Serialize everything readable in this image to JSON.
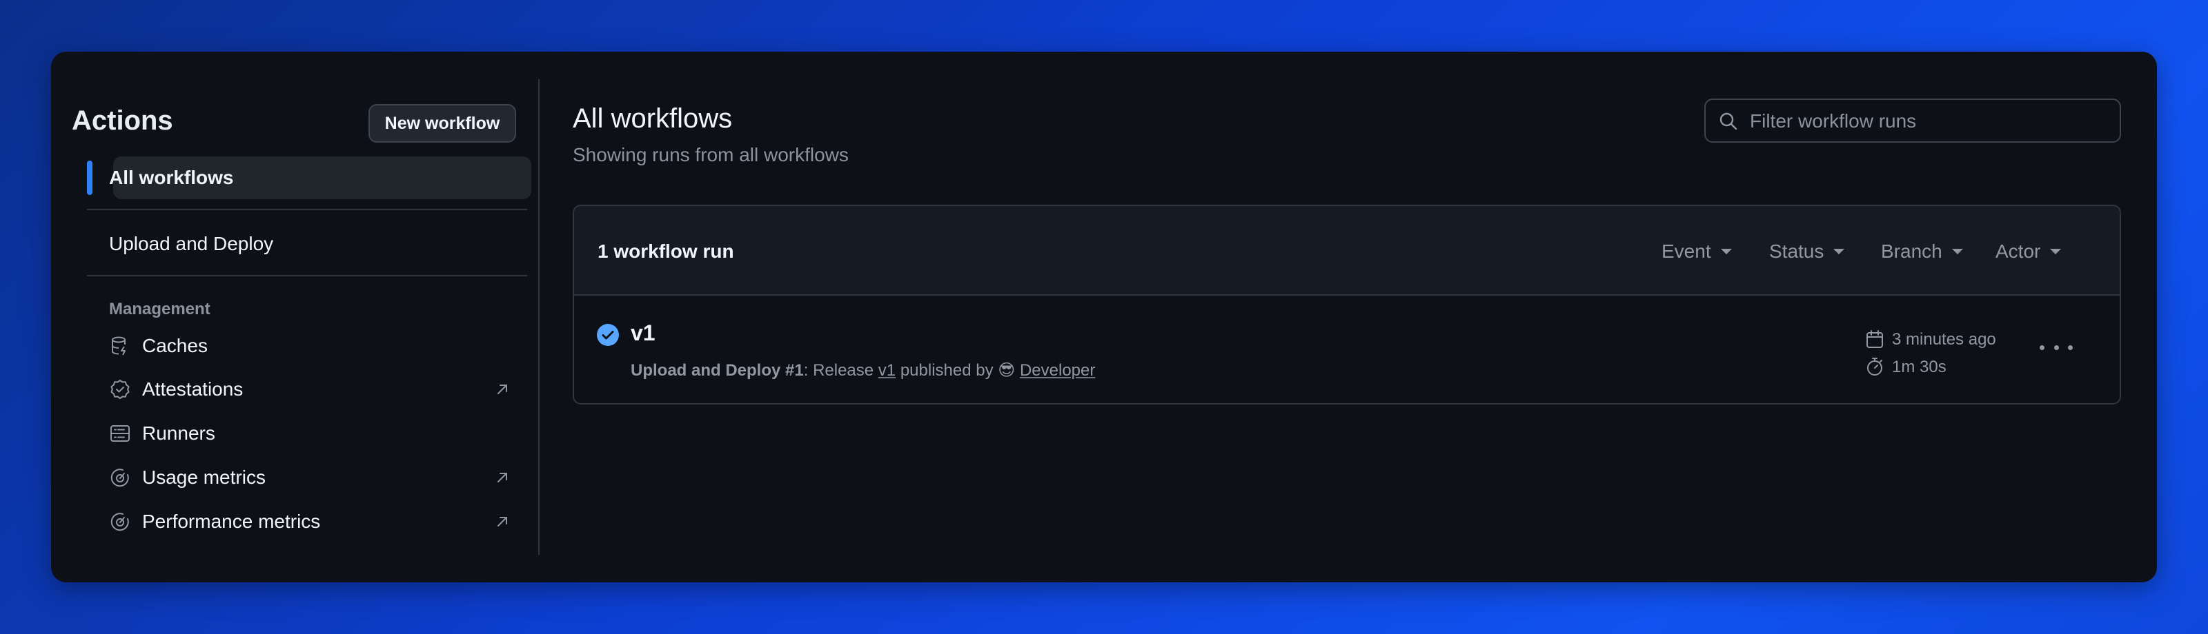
{
  "sidebar": {
    "title": "Actions",
    "new_workflow_label": "New workflow",
    "active_item": "All workflows",
    "workflow_item": "Upload and Deploy",
    "management_label": "Management",
    "management_items": [
      {
        "label": "Caches",
        "icon": "database-icon",
        "external": false
      },
      {
        "label": "Attestations",
        "icon": "badge-check-icon",
        "external": true
      },
      {
        "label": "Runners",
        "icon": "server-icon",
        "external": false
      },
      {
        "label": "Usage metrics",
        "icon": "meter-icon",
        "external": true
      },
      {
        "label": "Performance metrics",
        "icon": "meter-icon",
        "external": true
      }
    ]
  },
  "main": {
    "title": "All workflows",
    "subtitle": "Showing runs from all workflows",
    "filter_placeholder": "Filter workflow runs",
    "runs": {
      "count_label": "1 workflow run",
      "filters": [
        "Event",
        "Status",
        "Branch",
        "Actor"
      ],
      "items": [
        {
          "title": "v1",
          "workflow": "Upload and Deploy",
          "run_number": "#1",
          "description_prefix": ": Release ",
          "tag": "v1",
          "published_by": " published by ",
          "actor_emoji": "😎",
          "actor": "Developer",
          "time_ago": "3 minutes ago",
          "duration": "1m 30s",
          "status": "success"
        }
      ]
    }
  },
  "colors": {
    "background": "#0d1117",
    "accent": "#2f81f7",
    "success": "#58a6ff"
  }
}
